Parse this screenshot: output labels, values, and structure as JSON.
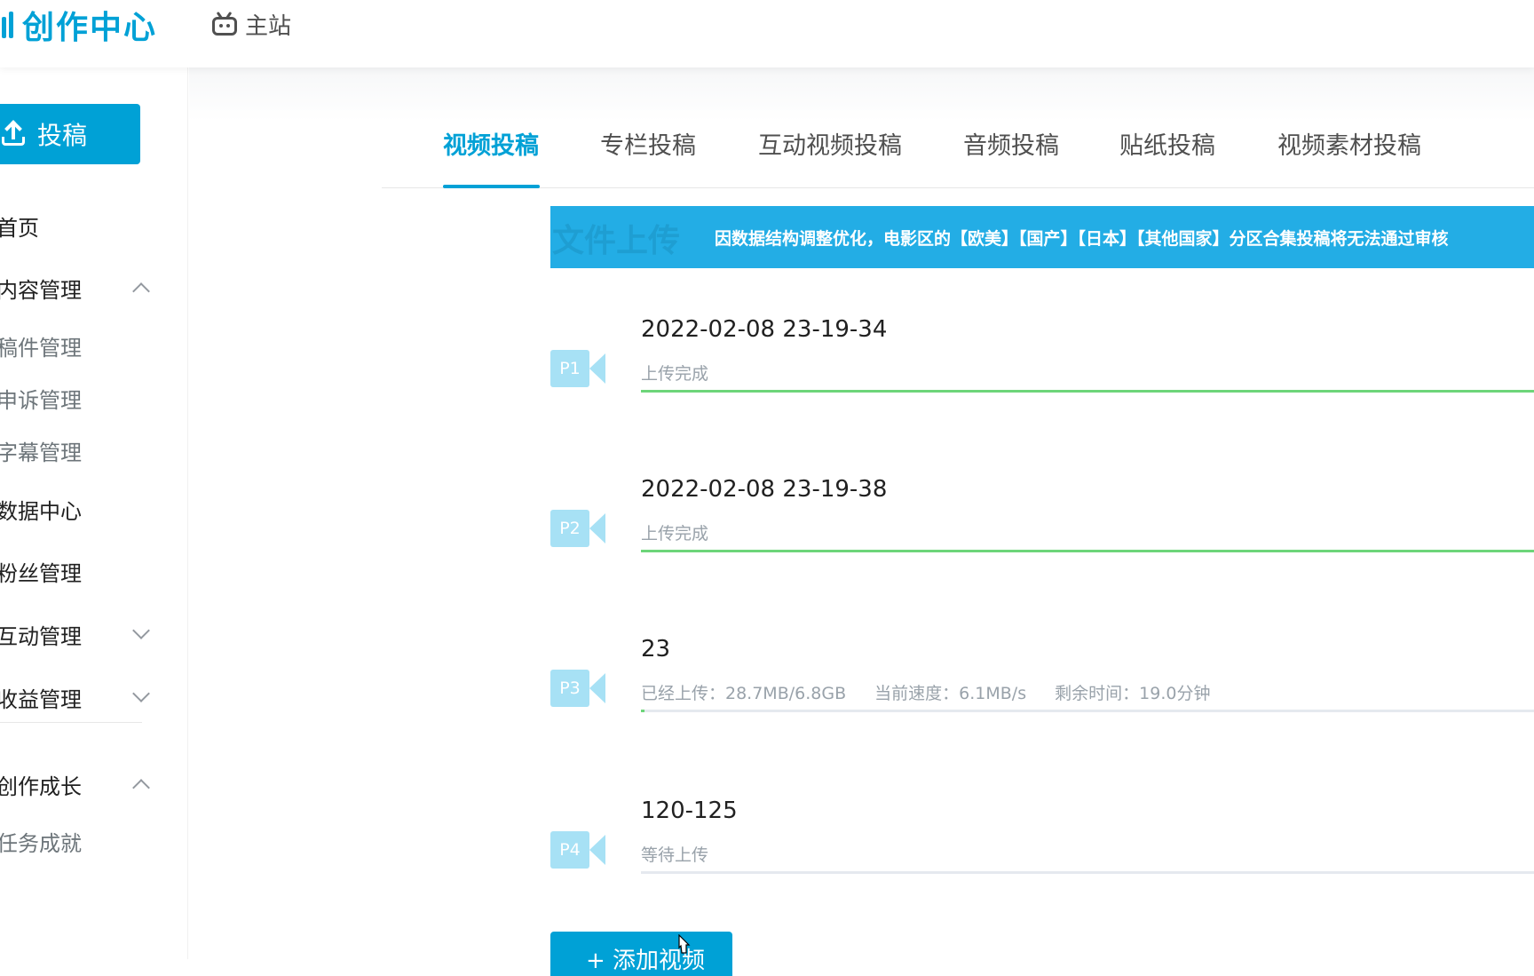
{
  "header": {
    "logo_text": "创作中心",
    "home_label": "主站"
  },
  "sidebar": {
    "upload_label": "投稿",
    "items": [
      {
        "label": "首页"
      },
      {
        "label": "内容管理",
        "expand": "up"
      },
      {
        "label": "稿件管理"
      },
      {
        "label": "申诉管理"
      },
      {
        "label": "字幕管理"
      },
      {
        "label": "数据中心"
      },
      {
        "label": "粉丝管理"
      },
      {
        "label": "互动管理",
        "expand": "down"
      },
      {
        "label": "收益管理",
        "expand": "down"
      },
      {
        "label": "创作成长",
        "expand": "up"
      },
      {
        "label": "任务成就"
      }
    ]
  },
  "tabs": [
    "视频投稿",
    "专栏投稿",
    "互动视频投稿",
    "音频投稿",
    "贴纸投稿",
    "视频素材投稿"
  ],
  "active_tab": "视频投稿",
  "banner": {
    "title": "文件上传",
    "notice": "因数据结构调整优化，电影区的【欧美】【国产】【日本】【其他国家】分区合集投稿将无法通过审核"
  },
  "files": [
    {
      "badge": "P1",
      "name": "2022-02-08 23-19-34",
      "status": "上传完成",
      "progress": 1.0
    },
    {
      "badge": "P2",
      "name": "2022-02-08 23-19-38",
      "status": "上传完成",
      "progress": 1.0
    },
    {
      "badge": "P3",
      "name": "23",
      "status_parts": [
        "已经上传：28.7MB/6.8GB",
        "当前速度：6.1MB/s",
        "剩余时间：19.0分钟"
      ],
      "progress": 0.004
    },
    {
      "badge": "P4",
      "name": "120-125",
      "status": "等待上传",
      "progress": 0.0
    }
  ],
  "add_button_label": "+ 添加视频",
  "colors": {
    "brand": "#00a1d6",
    "banner": "#23ade5",
    "progress_done": "#6dd57a",
    "camera_icon": "#a7e1f5"
  }
}
